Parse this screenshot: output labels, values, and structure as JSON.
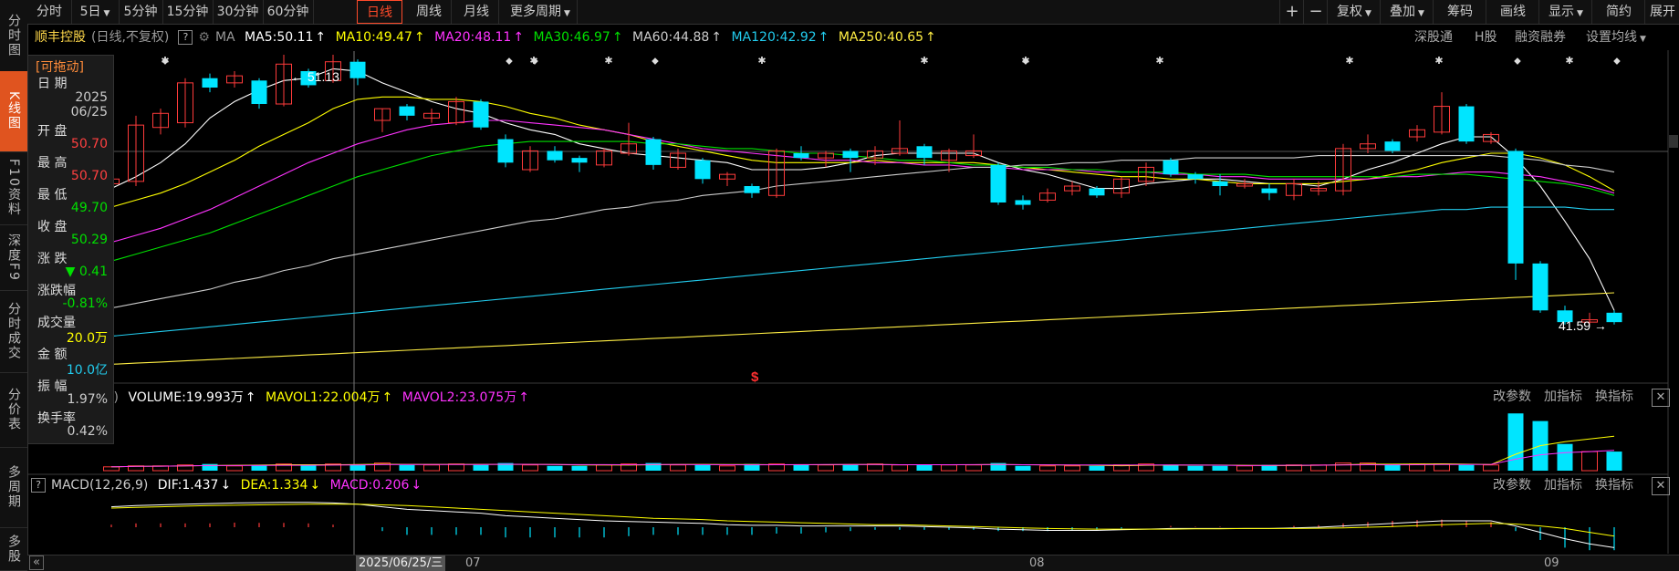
{
  "side_tabs": [
    {
      "label": "分时图",
      "active": false
    },
    {
      "label": "K线图",
      "active": true
    },
    {
      "label": "F10资料",
      "active": false
    },
    {
      "label": "深度F9",
      "active": false
    },
    {
      "label": "分时成交",
      "active": false
    },
    {
      "label": "分价表",
      "active": false
    },
    {
      "label": "多周期",
      "active": false
    },
    {
      "label": "多股",
      "active": false
    }
  ],
  "period_tabs": [
    "分时",
    "5日",
    "5分钟",
    "15分钟",
    "30分钟",
    "60分钟",
    "日线",
    "周线",
    "月线",
    "更多周期"
  ],
  "active_period": "日线",
  "toolbar": {
    "plus": "+",
    "minus": "−",
    "fuquan": "复权",
    "diejia": "叠加",
    "chouma": "筹码",
    "huaxian": "画线",
    "xianshi": "显示",
    "jianyue": "简约",
    "zhankai": "展开"
  },
  "header": {
    "stock_name": "顺丰控股",
    "mode": "(日线,不复权)",
    "ma_label": "MA",
    "ma5": "MA5:50.11",
    "ma10": "MA10:49.47",
    "ma20": "MA20:48.11",
    "ma30": "MA30:46.97",
    "ma60": "MA60:44.88",
    "ma120": "MA120:42.92",
    "ma250": "MA250:40.65"
  },
  "right_links": [
    "深股通",
    "H股",
    "融资融券",
    "设置均线"
  ],
  "info_panel": {
    "title": "[可拖动]",
    "date_label": "日 期",
    "date_year": "2025",
    "date_md": "06/25",
    "open_label": "开 盘",
    "open": "50.70",
    "high_label": "最 高",
    "high": "50.70",
    "low_label": "最 低",
    "low": "49.70",
    "close_label": "收 盘",
    "close": "50.29",
    "change_label": "涨 跌",
    "change": "▼ 0.41",
    "pct_label": "涨跌幅",
    "pct": "-0.81%",
    "vol_label": "成交量",
    "vol": "20.0万",
    "amt_label": "金 额",
    "amt": "10.0亿",
    "amp_label": "振 幅",
    "amp": "1.97%",
    "turn_label": "换手率",
    "turn": "0.42%"
  },
  "annotations": {
    "high": "51.13",
    "low": "41.59",
    "event": "$"
  },
  "volume_header": {
    "prefix": ")",
    "volume": "VOLUME:19.993万",
    "mavol1": "MAVOL1:22.004万",
    "mavol2": "MAVOL2:23.075万"
  },
  "macd_header": {
    "name": "MACD(12,26,9)",
    "dif": "DIF:1.437",
    "dea": "DEA:1.334",
    "macd": "MACD:0.206"
  },
  "sub_links": [
    "改参数",
    "加指标",
    "换指标"
  ],
  "date_bar": {
    "nav": "«",
    "cursor_date": "2025/06/25/三",
    "months": [
      "07",
      "08",
      "09"
    ]
  },
  "colors": {
    "up": "#ff3b3b",
    "down": "#00e5ff",
    "ma5": "#ffffff",
    "ma10": "#ffff00",
    "ma20": "#ff33ff",
    "ma30": "#00e000",
    "ma60": "#cccccc",
    "ma120": "#22ccee",
    "ma250": "#ffee44"
  },
  "chart_data": {
    "type": "candlestick",
    "price_range": [
      39,
      53
    ],
    "candles": [
      {
        "o": 47.5,
        "c": 47.7,
        "h": 48.0,
        "l": 47.2
      },
      {
        "o": 47.6,
        "c": 50.0,
        "h": 50.4,
        "l": 47.4
      },
      {
        "o": 49.9,
        "c": 50.5,
        "h": 50.7,
        "l": 49.6
      },
      {
        "o": 50.1,
        "c": 51.8,
        "h": 52.0,
        "l": 49.9
      },
      {
        "o": 52.0,
        "c": 51.6,
        "h": 52.2,
        "l": 51.4
      },
      {
        "o": 51.8,
        "c": 52.1,
        "h": 52.3,
        "l": 51.6
      },
      {
        "o": 51.9,
        "c": 50.9,
        "h": 52.0,
        "l": 50.7
      },
      {
        "o": 50.9,
        "c": 52.6,
        "h": 53.0,
        "l": 50.8
      },
      {
        "o": 52.3,
        "c": 51.7,
        "h": 52.4,
        "l": 51.6
      },
      {
        "o": 51.9,
        "c": 52.7,
        "h": 53.0,
        "l": 51.8
      },
      {
        "o": 52.7,
        "c": 52.0,
        "h": 52.8,
        "l": 51.7
      },
      {
        "o": 50.2,
        "c": 50.7,
        "h": 50.7,
        "l": 49.7
      },
      {
        "o": 50.8,
        "c": 50.4,
        "h": 50.9,
        "l": 50.2
      },
      {
        "o": 50.3,
        "c": 50.5,
        "h": 50.7,
        "l": 50.1
      },
      {
        "o": 50.1,
        "c": 51.0,
        "h": 51.2,
        "l": 50.0
      },
      {
        "o": 51.0,
        "c": 49.9,
        "h": 51.1,
        "l": 49.8
      },
      {
        "o": 49.4,
        "c": 48.4,
        "h": 49.6,
        "l": 48.2
      },
      {
        "o": 48.1,
        "c": 48.9,
        "h": 49.1,
        "l": 48.0
      },
      {
        "o": 48.9,
        "c": 48.5,
        "h": 49.1,
        "l": 48.4
      },
      {
        "o": 48.6,
        "c": 48.4,
        "h": 48.7,
        "l": 48.0
      },
      {
        "o": 48.3,
        "c": 48.9,
        "h": 49.0,
        "l": 48.2
      },
      {
        "o": 48.8,
        "c": 49.2,
        "h": 50.1,
        "l": 48.7
      },
      {
        "o": 49.4,
        "c": 48.3,
        "h": 49.5,
        "l": 48.1
      },
      {
        "o": 48.2,
        "c": 48.8,
        "h": 49.0,
        "l": 48.1
      },
      {
        "o": 48.5,
        "c": 47.7,
        "h": 48.6,
        "l": 47.5
      },
      {
        "o": 47.7,
        "c": 47.9,
        "h": 48.0,
        "l": 47.4
      },
      {
        "o": 47.4,
        "c": 47.1,
        "h": 47.5,
        "l": 46.9
      },
      {
        "o": 47.0,
        "c": 48.9,
        "h": 49.0,
        "l": 46.9
      },
      {
        "o": 48.8,
        "c": 48.6,
        "h": 49.1,
        "l": 48.5
      },
      {
        "o": 48.6,
        "c": 48.8,
        "h": 48.9,
        "l": 48.2
      },
      {
        "o": 48.9,
        "c": 48.6,
        "h": 49.0,
        "l": 48.0
      },
      {
        "o": 48.6,
        "c": 48.9,
        "h": 49.1,
        "l": 48.3
      },
      {
        "o": 48.8,
        "c": 49.0,
        "h": 50.2,
        "l": 48.7
      },
      {
        "o": 49.1,
        "c": 48.6,
        "h": 49.2,
        "l": 48.3
      },
      {
        "o": 48.5,
        "c": 48.9,
        "h": 49.0,
        "l": 48.0
      },
      {
        "o": 48.7,
        "c": 48.9,
        "h": 49.6,
        "l": 48.6
      },
      {
        "o": 48.3,
        "c": 46.7,
        "h": 48.4,
        "l": 46.6
      },
      {
        "o": 46.8,
        "c": 46.6,
        "h": 47.0,
        "l": 46.4
      },
      {
        "o": 46.8,
        "c": 47.1,
        "h": 47.3,
        "l": 46.7
      },
      {
        "o": 47.2,
        "c": 47.4,
        "h": 47.6,
        "l": 47.0
      },
      {
        "o": 47.3,
        "c": 47.0,
        "h": 47.4,
        "l": 46.9
      },
      {
        "o": 47.1,
        "c": 47.7,
        "h": 47.8,
        "l": 46.9
      },
      {
        "o": 47.6,
        "c": 48.2,
        "h": 48.4,
        "l": 47.4
      },
      {
        "o": 48.5,
        "c": 47.9,
        "h": 48.6,
        "l": 47.8
      },
      {
        "o": 47.9,
        "c": 47.7,
        "h": 48.0,
        "l": 47.5
      },
      {
        "o": 47.6,
        "c": 47.4,
        "h": 47.9,
        "l": 47.0
      },
      {
        "o": 47.4,
        "c": 47.5,
        "h": 47.7,
        "l": 47.3
      },
      {
        "o": 47.3,
        "c": 47.1,
        "h": 47.5,
        "l": 46.8
      },
      {
        "o": 47.0,
        "c": 47.5,
        "h": 47.7,
        "l": 46.8
      },
      {
        "o": 47.2,
        "c": 47.3,
        "h": 47.6,
        "l": 47.0
      },
      {
        "o": 47.2,
        "c": 49.0,
        "h": 49.2,
        "l": 47.0
      },
      {
        "o": 49.0,
        "c": 49.2,
        "h": 49.6,
        "l": 48.8
      },
      {
        "o": 49.3,
        "c": 48.9,
        "h": 49.4,
        "l": 48.8
      },
      {
        "o": 49.5,
        "c": 49.8,
        "h": 50.0,
        "l": 49.3
      },
      {
        "o": 49.7,
        "c": 50.8,
        "h": 51.4,
        "l": 49.6
      },
      {
        "o": 50.8,
        "c": 49.3,
        "h": 50.9,
        "l": 49.2
      },
      {
        "o": 49.3,
        "c": 49.6,
        "h": 49.7,
        "l": 49.2
      },
      {
        "o": 48.9,
        "c": 44.1,
        "h": 49.0,
        "l": 43.4
      },
      {
        "o": 44.1,
        "c": 42.1,
        "h": 44.2,
        "l": 42.0
      },
      {
        "o": 42.1,
        "c": 41.6,
        "h": 42.3,
        "l": 41.5
      },
      {
        "o": 41.6,
        "c": 41.7,
        "h": 42.0,
        "l": 41.5
      },
      {
        "o": 42.0,
        "c": 41.6,
        "h": 42.1,
        "l": 41.5
      }
    ],
    "ma_lines": {
      "ma5": [
        47.3,
        47.8,
        48.4,
        49.2,
        50.3,
        51.0,
        51.5,
        51.9,
        52.0,
        52.4,
        52.3,
        51.8,
        51.4,
        51.0,
        50.7,
        50.5,
        50.1,
        49.8,
        49.6,
        49.2,
        49.0,
        48.8,
        48.7,
        48.6,
        48.5,
        48.4,
        48.1,
        48.1,
        48.1,
        48.2,
        48.4,
        48.7,
        48.8,
        48.8,
        48.8,
        48.8,
        48.4,
        48.1,
        47.9,
        47.6,
        47.3,
        47.3,
        47.5,
        47.6,
        47.7,
        47.7,
        47.6,
        47.5,
        47.5,
        47.4,
        47.7,
        48.1,
        48.4,
        48.8,
        49.2,
        49.5,
        49.5,
        48.6,
        47.4,
        45.9,
        44.3,
        42.1
      ],
      "ma10": [
        46.5,
        46.8,
        47.1,
        47.5,
        48.0,
        48.5,
        49.1,
        49.6,
        50.1,
        50.7,
        51.1,
        51.2,
        51.2,
        51.1,
        51.1,
        51.0,
        50.8,
        50.5,
        50.3,
        50.0,
        49.8,
        49.6,
        49.3,
        49.1,
        48.9,
        48.7,
        48.5,
        48.4,
        48.4,
        48.4,
        48.4,
        48.5,
        48.4,
        48.4,
        48.4,
        48.4,
        48.3,
        48.2,
        48.1,
        48.0,
        47.9,
        47.8,
        47.8,
        47.7,
        47.7,
        47.6,
        47.5,
        47.5,
        47.5,
        47.5,
        47.6,
        47.7,
        47.9,
        48.1,
        48.4,
        48.6,
        48.8,
        48.8,
        48.6,
        48.3,
        47.8,
        47.2
      ],
      "ma20": [
        45.0,
        45.3,
        45.6,
        46.0,
        46.4,
        46.9,
        47.4,
        47.9,
        48.4,
        48.8,
        49.2,
        49.5,
        49.8,
        50.0,
        50.1,
        50.2,
        50.2,
        50.1,
        50.0,
        49.9,
        49.8,
        49.6,
        49.4,
        49.2,
        49.0,
        48.9,
        48.8,
        48.7,
        48.6,
        48.5,
        48.5,
        48.4,
        48.4,
        48.3,
        48.3,
        48.2,
        48.2,
        48.1,
        48.1,
        48.1,
        48.0,
        48.0,
        48.0,
        47.9,
        47.9,
        47.8,
        47.8,
        47.7,
        47.7,
        47.7,
        47.7,
        47.7,
        47.8,
        47.8,
        47.9,
        48.0,
        48.0,
        47.9,
        47.8,
        47.6,
        47.4,
        47.1
      ],
      "ma30": [
        44.2,
        44.5,
        44.8,
        45.1,
        45.4,
        45.8,
        46.2,
        46.6,
        47.0,
        47.4,
        47.8,
        48.1,
        48.4,
        48.7,
        48.9,
        49.1,
        49.2,
        49.3,
        49.3,
        49.3,
        49.3,
        49.3,
        49.2,
        49.2,
        49.1,
        49.0,
        49.0,
        48.9,
        48.8,
        48.8,
        48.7,
        48.6,
        48.5,
        48.5,
        48.4,
        48.3,
        48.3,
        48.2,
        48.2,
        48.1,
        48.1,
        48.0,
        48.0,
        48.0,
        47.9,
        47.9,
        47.9,
        47.8,
        47.8,
        47.8,
        47.8,
        47.8,
        47.8,
        47.9,
        47.9,
        47.9,
        47.8,
        47.7,
        47.6,
        47.5,
        47.3,
        47.0
      ],
      "ma60": [
        42.2,
        42.4,
        42.6,
        42.8,
        43.0,
        43.3,
        43.5,
        43.8,
        44.0,
        44.3,
        44.5,
        44.7,
        44.9,
        45.1,
        45.3,
        45.5,
        45.7,
        45.9,
        46.0,
        46.2,
        46.4,
        46.5,
        46.7,
        46.8,
        47.0,
        47.1,
        47.2,
        47.4,
        47.5,
        47.6,
        47.7,
        47.8,
        47.9,
        48.0,
        48.1,
        48.2,
        48.2,
        48.3,
        48.3,
        48.4,
        48.4,
        48.5,
        48.5,
        48.5,
        48.6,
        48.6,
        48.6,
        48.6,
        48.6,
        48.7,
        48.7,
        48.7,
        48.7,
        48.7,
        48.7,
        48.7,
        48.7,
        48.6,
        48.5,
        48.3,
        48.2,
        48.0
      ],
      "ma120": [
        41.0,
        41.1,
        41.2,
        41.3,
        41.4,
        41.5,
        41.6,
        41.7,
        41.8,
        41.9,
        42.0,
        42.1,
        42.2,
        42.3,
        42.4,
        42.5,
        42.6,
        42.7,
        42.8,
        42.9,
        43.0,
        43.1,
        43.2,
        43.3,
        43.4,
        43.5,
        43.6,
        43.7,
        43.8,
        43.9,
        44.0,
        44.1,
        44.2,
        44.3,
        44.4,
        44.5,
        44.6,
        44.7,
        44.8,
        44.9,
        45.0,
        45.1,
        45.2,
        45.3,
        45.4,
        45.5,
        45.6,
        45.7,
        45.8,
        45.9,
        46.0,
        46.1,
        46.2,
        46.3,
        46.4,
        46.4,
        46.5,
        46.5,
        46.5,
        46.5,
        46.4,
        46.4
      ],
      "ma250": [
        39.8,
        39.85,
        39.9,
        39.95,
        40.0,
        40.05,
        40.1,
        40.15,
        40.2,
        40.25,
        40.3,
        40.35,
        40.4,
        40.45,
        40.5,
        40.55,
        40.6,
        40.65,
        40.7,
        40.75,
        40.8,
        40.85,
        40.9,
        40.95,
        41.0,
        41.05,
        41.1,
        41.15,
        41.2,
        41.25,
        41.3,
        41.35,
        41.4,
        41.45,
        41.5,
        41.55,
        41.6,
        41.65,
        41.7,
        41.75,
        41.8,
        41.85,
        41.9,
        41.95,
        42.0,
        42.05,
        42.1,
        42.15,
        42.2,
        42.25,
        42.3,
        42.35,
        42.4,
        42.45,
        42.5,
        42.55,
        42.6,
        42.65,
        42.7,
        42.75,
        42.8,
        42.85
      ]
    },
    "volume": [
      0.4,
      0.5,
      0.5,
      0.6,
      0.7,
      0.5,
      0.6,
      0.7,
      0.6,
      0.7,
      0.6,
      0.8,
      0.6,
      0.6,
      0.7,
      0.6,
      0.8,
      0.6,
      0.5,
      0.5,
      0.6,
      0.7,
      0.8,
      0.6,
      0.6,
      0.5,
      0.7,
      0.7,
      0.6,
      0.6,
      0.6,
      0.7,
      0.6,
      0.6,
      0.6,
      0.6,
      0.8,
      0.5,
      0.5,
      0.5,
      0.5,
      0.6,
      0.7,
      0.6,
      0.5,
      0.5,
      0.5,
      0.6,
      0.6,
      0.6,
      0.8,
      0.8,
      0.6,
      0.7,
      0.7,
      0.6,
      0.6,
      6.0,
      5.2,
      2.8,
      2.0,
      2.0
    ],
    "macd_dif": [
      1.6,
      1.7,
      1.75,
      1.8,
      1.85,
      1.9,
      1.92,
      1.95,
      1.95,
      1.9,
      1.8,
      1.6,
      1.4,
      1.3,
      1.2,
      1.1,
      0.9,
      0.8,
      0.7,
      0.6,
      0.5,
      0.45,
      0.4,
      0.35,
      0.3,
      0.2,
      0.15,
      0.15,
      0.1,
      0.1,
      0.1,
      0.1,
      0.1,
      0.05,
      0.0,
      -0.05,
      -0.15,
      -0.2,
      -0.25,
      -0.25,
      -0.25,
      -0.2,
      -0.15,
      -0.1,
      -0.1,
      -0.1,
      -0.1,
      -0.1,
      -0.05,
      0.0,
      0.1,
      0.2,
      0.3,
      0.4,
      0.5,
      0.5,
      0.5,
      0.1,
      -0.4,
      -0.9,
      -1.3,
      -1.6
    ],
    "macd_dea": [
      1.5,
      1.55,
      1.6,
      1.65,
      1.7,
      1.72,
      1.75,
      1.78,
      1.8,
      1.8,
      1.8,
      1.75,
      1.7,
      1.6,
      1.5,
      1.4,
      1.3,
      1.2,
      1.1,
      1.0,
      0.9,
      0.8,
      0.7,
      0.65,
      0.6,
      0.5,
      0.45,
      0.4,
      0.35,
      0.3,
      0.25,
      0.2,
      0.2,
      0.15,
      0.1,
      0.05,
      0.0,
      -0.05,
      -0.1,
      -0.12,
      -0.15,
      -0.15,
      -0.15,
      -0.15,
      -0.12,
      -0.12,
      -0.1,
      -0.1,
      -0.1,
      -0.08,
      -0.05,
      0.0,
      0.05,
      0.12,
      0.2,
      0.25,
      0.3,
      0.25,
      0.1,
      -0.1,
      -0.4,
      -0.7
    ]
  }
}
